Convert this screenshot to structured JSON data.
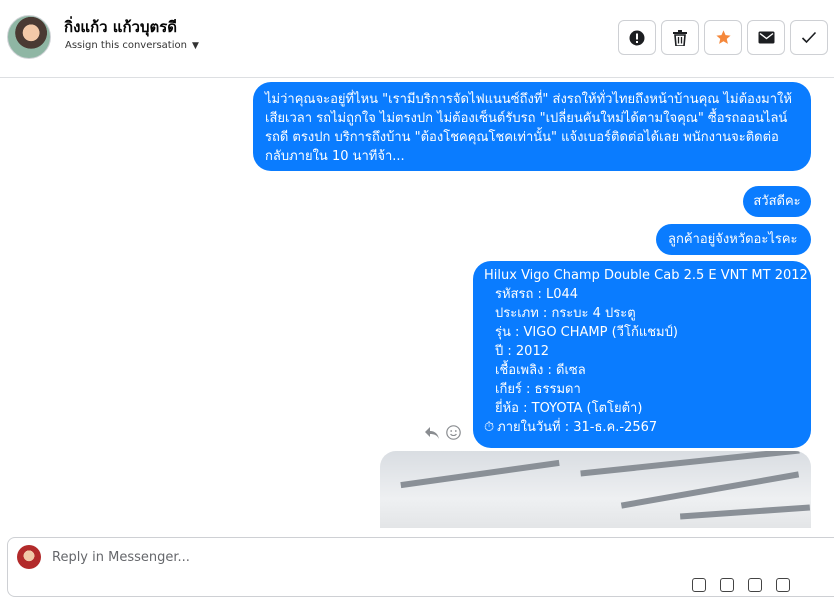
{
  "header": {
    "contact_name": "กิ่งแก้ว แก้วบุตรดี",
    "assign_label": "Assign this conversation",
    "actions": [
      {
        "name": "mark-spam",
        "icon": "exclamation-circle-icon"
      },
      {
        "name": "delete",
        "icon": "trash-icon"
      },
      {
        "name": "star",
        "icon": "star-icon",
        "color": "#f5883b"
      },
      {
        "name": "mark-unread",
        "icon": "envelope-icon"
      },
      {
        "name": "mark-done",
        "icon": "checkmark-icon"
      }
    ]
  },
  "messages": [
    {
      "text": "ไม่ว่าคุณจะอยู่ที่ไหน \"เรามีบริการจัดไฟแนนซ์ถึงที่\"  ส่งรถให้ทั่วไทยถึงหน้าบ้านคุณ ไม่ต้องมาให้เสียเวลา รถไม่ถูกใจ ไม่ตรงปก ไม่ต้องเซ็นต์รับรถ \"เปลี่ยนคันใหม่ได้ตามใจคุณ\" ซื้อรถออนไลน์ รถดี ตรงปก บริการถึงบ้าน \"ต้องโชคคุณโชคเท่านั้น\" แจ้งเบอร์ติดต่อได้เลย พนักงานจะติดต่อกลับภายใน 10 นาทีจ้า..."
    },
    {
      "text": "สวัสดีคะ"
    },
    {
      "text": "ลูกค้าอยู่จังหวัดอะไรคะ"
    },
    {
      "title": "Hilux Vigo Champ Double Cab 2.5 E VNT MT 2012",
      "details": [
        "รหัสรถ : L044",
        "ประเภท : กระบะ 4 ประตู",
        "รุ่น : VIGO CHAMP (วีโก้แชมป์)",
        "ปี : 2012",
        "เชื้อเพลิง : ดีเซล",
        "เกียร์ : ธรรมดา",
        "ยี่ห้อ : TOYOTA (โตโยต้า)"
      ],
      "timer_line": "ภายในวันที่ : 31-ธ.ค.-2567"
    }
  ],
  "reply": {
    "placeholder": "Reply in Messenger..."
  },
  "colors": {
    "bubble": "#0a7cff",
    "star": "#f5883b"
  }
}
